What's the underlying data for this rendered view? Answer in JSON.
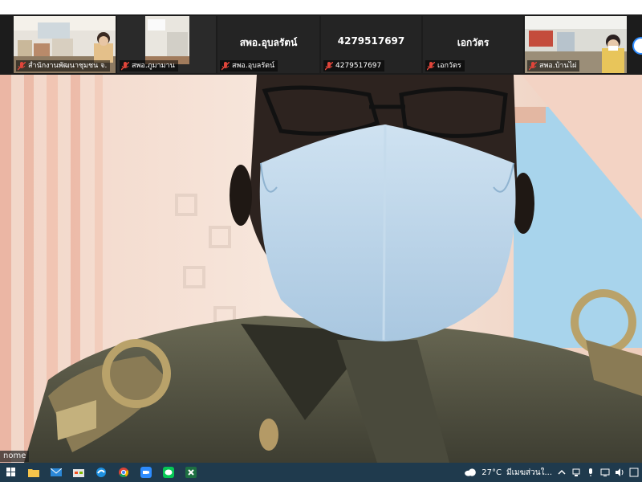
{
  "gallery": {
    "tiles": [
      {
        "label": "สำนักงานพัฒนาชุมชน จ.",
        "type": "video"
      },
      {
        "label": "สพอ.ภูมามาน",
        "type": "video"
      },
      {
        "label": "สพอ.อุบลรัตน์",
        "center_name": "สพอ.อุบลรัตน์",
        "type": "name"
      },
      {
        "label": "4279517697",
        "center_name": "4279517697",
        "type": "name"
      },
      {
        "label": "เอกวัตร",
        "center_name": "เอกวัตร",
        "type": "name"
      },
      {
        "label": "สพอ.บ้านไผ่",
        "type": "video"
      }
    ]
  },
  "main": {
    "speaker_label": "nome"
  },
  "taskbar": {
    "apps": [
      "start-icon",
      "file-explorer-icon",
      "mail-icon",
      "store-icon",
      "edge-icon",
      "chrome-icon",
      "zoom-icon",
      "line-icon",
      "excel-icon"
    ],
    "weather_temp": "27°C",
    "weather_text": "มีเมฆส่วนใ..."
  },
  "colors": {
    "gallery_bg": "#1c1c1c",
    "taskbar_bg": "#1f3a4d",
    "mask": "#b8d3e8",
    "uniform": "#5b5a48",
    "gold": "#b9a26a"
  }
}
